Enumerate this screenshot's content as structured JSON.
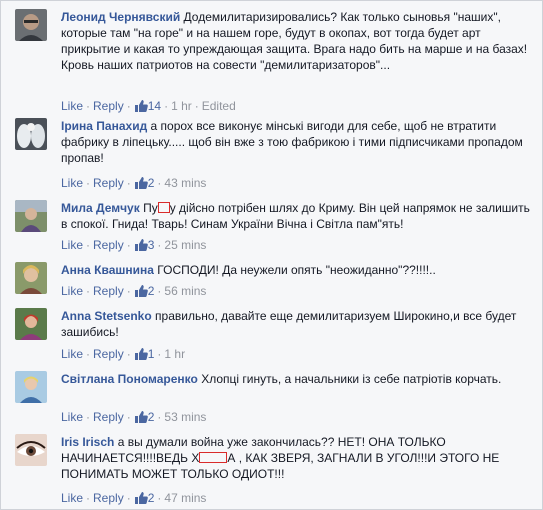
{
  "actions": {
    "like": "Like",
    "reply": "Reply",
    "sep": "·"
  },
  "comments": [
    {
      "author": "Леонид Чернявский",
      "text": "Додемилитаризировались? Как только сыновья \"наших\", которые там \"на горе\" и на нашем горе, будут в окопах, вот тогда будет арт прикрытие и какая то упреждающая защита. Врага надо бить на марше и на базах! Кровь наших патриотов на совести \"демилитаризаторов\"...",
      "likes": "14",
      "time": "1 hr",
      "edited": "Edited",
      "avatar": "man-with-glasses-avatar"
    },
    {
      "author": "Ірина Панахид",
      "text": "а порох все виконує мінські вигоди для себе, щоб не втратити фабрику в ліпецьку..... щоб він вже з тою фабрикою і тими підписчиками пропадом пропав!",
      "likes": "2",
      "time": "43 mins",
      "avatar": "angels-avatar"
    },
    {
      "author": "Мила Демчук",
      "text_before": "Пу",
      "text_after": "у дійсно потрібен шлях до Криму. Він цей напрямок не залишить в спокої. Гнида! Тварь! Синам України Вічна і Світла пам\"ять!",
      "likes": "3",
      "time": "25 mins",
      "avatar": "woman-outdoors-avatar"
    },
    {
      "author": "Анна Квашнина",
      "text": "ГОСПОДИ! Да неужели опять \"неожиданно\"??!!!!..",
      "likes": "2",
      "time": "56 mins",
      "avatar": "woman-blonde-avatar"
    },
    {
      "author": "Anna Stetsenko",
      "text": "правильно, давайте еще демилитаризуем Широкино,и все будет зашибись!",
      "likes": "1",
      "time": "1 hr",
      "avatar": "woman-red-hair-avatar"
    },
    {
      "author": "Світлана Пономаренко",
      "text": "Хлопці гинуть, а начальники із себе патріотів корчать.",
      "likes": "2",
      "time": "53 mins",
      "avatar": "woman-sky-avatar"
    },
    {
      "author": "Iris Irisch",
      "text_before": "а вы думали война уже закончилась?? НЕТ! ОНА ТОЛЬКО НАЧИНАЕТСЯ!!!!ВЕДЬ Х",
      "text_after": "А , КАК ЗВЕРЯ, ЗАГНАЛИ В УГОЛ!!!И ЭТОГО НЕ ПОНИМАТЬ МОЖЕТ ТОЛЬКО ОДИОТ!!!",
      "likes": "2",
      "time": "47 mins",
      "avatar": "eye-closeup-avatar"
    }
  ],
  "colors": {
    "author": "#365899",
    "link": "#4b67a1",
    "meta": "#90949c",
    "censor": "#d92b2b"
  }
}
